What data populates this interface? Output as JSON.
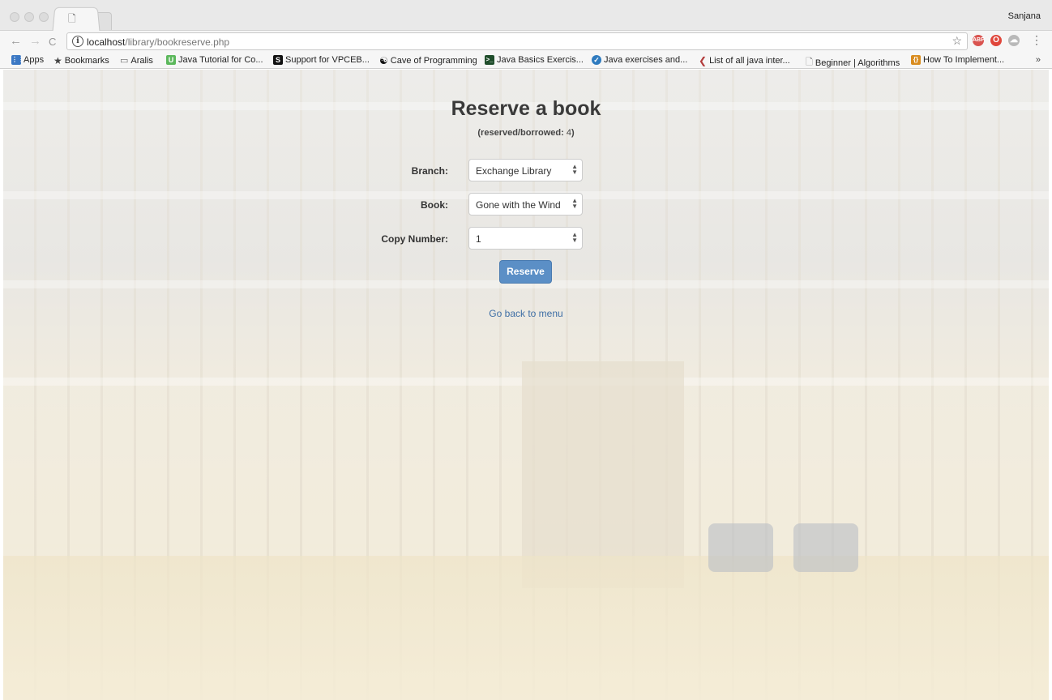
{
  "browser": {
    "tab_icon": "document-icon",
    "user_name": "Sanjana",
    "nav": {
      "back": "←",
      "forward": "→",
      "reload": "C"
    },
    "url_host": "localhost",
    "url_path": "/library/bookreserve.php",
    "star": "☆",
    "menu": "⋮",
    "extensions": [
      {
        "name": "abp-icon",
        "text": "ABP",
        "color": "#d9534f"
      },
      {
        "name": "opera-icon",
        "text": "O",
        "color": "#e0463b"
      },
      {
        "name": "cloud-icon",
        "text": "☁",
        "color": "#b9b9b9"
      }
    ]
  },
  "bookmarks": {
    "items": [
      {
        "label": "Apps",
        "icon": "apps-icon",
        "color": "#3b78c4"
      },
      {
        "label": "Bookmarks",
        "icon": "star-icon",
        "color": "#444444"
      },
      {
        "label": "Aralis",
        "icon": "folder-icon",
        "color": "#777777"
      },
      {
        "label": "Java Tutorial for Co...",
        "icon": "u-icon",
        "color": "#5cb85c"
      },
      {
        "label": "Support for VPCEB...",
        "icon": "s-icon",
        "color": "#111111"
      },
      {
        "label": "Cave of Programming",
        "icon": "yin-yang-icon",
        "color": "#111111"
      },
      {
        "label": "Java Basics Exercis...",
        "icon": "terminal-icon",
        "color": "#1f4d2b"
      },
      {
        "label": "Java exercises and...",
        "icon": "compass-icon",
        "color": "#2f7bbf"
      },
      {
        "label": "List of all java inter...",
        "icon": "quote-icon",
        "color": "#b23b3b"
      },
      {
        "label": "Beginner | Algorithms",
        "icon": "document-icon",
        "color": "#777777"
      },
      {
        "label": "How To Implement...",
        "icon": "brackets-icon",
        "color": "#d98c1f"
      }
    ],
    "more": "»"
  },
  "page": {
    "title": "Reserve a book",
    "subtitle_label": "(reserved/borrowed: ",
    "subtitle_count": "4",
    "subtitle_end": ")",
    "form": {
      "branch_label": "Branch:",
      "branch_value": "Exchange Library",
      "book_label": "Book:",
      "book_value": "Gone with the Wind",
      "copy_label": "Copy Number:",
      "copy_value": "1",
      "submit_label": "Reserve"
    },
    "back_link": "Go back to menu"
  }
}
